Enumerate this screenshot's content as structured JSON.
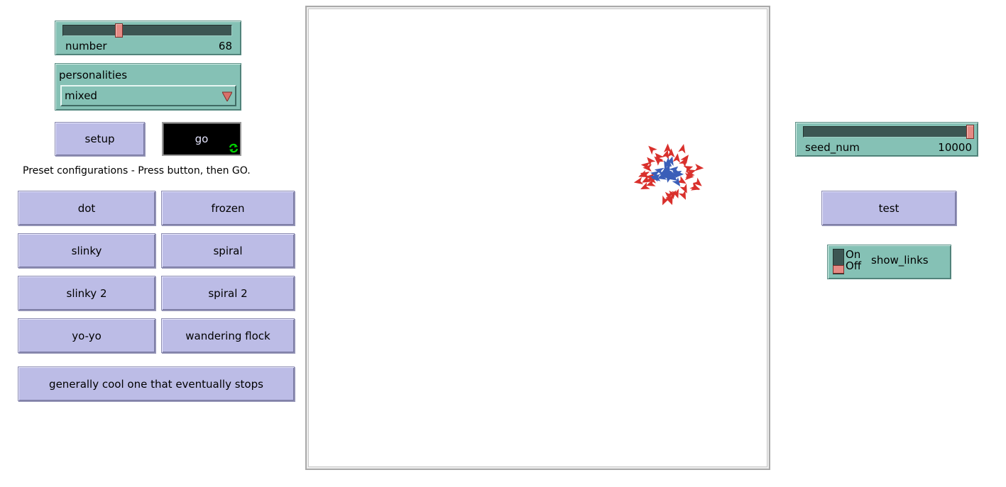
{
  "number_slider": {
    "label": "number",
    "value": "68",
    "min": 0,
    "max": 300
  },
  "personalities": {
    "label": "personalities",
    "selected": "mixed"
  },
  "buttons": {
    "setup": "setup",
    "go": "go",
    "test": "test"
  },
  "preset_note": "Preset configurations - Press button, then GO.",
  "presets": {
    "dot": "dot",
    "frozen": "frozen",
    "slinky": "slinky",
    "spiral": "spiral",
    "slinky2": "slinky 2",
    "spiral2": "spiral 2",
    "yoyo": "yo-yo",
    "wandering": "wandering flock",
    "cool": "generally cool one that eventually stops"
  },
  "seed_slider": {
    "label": "seed_num",
    "value": "10000",
    "fraction": 1.0
  },
  "show_links_switch": {
    "on_label": "On",
    "off_label": "Off",
    "label": "show_links",
    "state": "off"
  },
  "colors": {
    "widget_teal": "#85c1b5",
    "button_lavender": "#bcbce6",
    "turtle_red": "#d9302c",
    "turtle_blue": "#3a5eb8",
    "forever_icon": "#00d000"
  }
}
